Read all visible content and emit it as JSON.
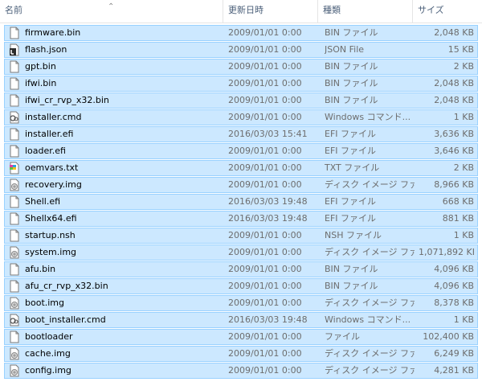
{
  "columns": {
    "name": "名前",
    "date": "更新日時",
    "type": "種類",
    "size": "サイズ"
  },
  "files": [
    {
      "name": "firmware.bin",
      "date": "2009/01/01 0:00",
      "type": "BIN ファイル",
      "size": "2,048 KB",
      "icon": "generic-file-icon"
    },
    {
      "name": "flash.json",
      "date": "2009/01/01 0:00",
      "type": "JSON File",
      "size": "15 KB",
      "icon": "json-file-icon"
    },
    {
      "name": "gpt.bin",
      "date": "2009/01/01 0:00",
      "type": "BIN ファイル",
      "size": "2 KB",
      "icon": "generic-file-icon"
    },
    {
      "name": "ifwi.bin",
      "date": "2009/01/01 0:00",
      "type": "BIN ファイル",
      "size": "2,048 KB",
      "icon": "generic-file-icon"
    },
    {
      "name": "ifwi_cr_rvp_x32.bin",
      "date": "2009/01/01 0:00",
      "type": "BIN ファイル",
      "size": "2,048 KB",
      "icon": "generic-file-icon"
    },
    {
      "name": "installer.cmd",
      "date": "2009/01/01 0:00",
      "type": "Windows コマンド...",
      "size": "1 KB",
      "icon": "cmd-file-icon"
    },
    {
      "name": "installer.efi",
      "date": "2016/03/03 15:41",
      "type": "EFI ファイル",
      "size": "3,636 KB",
      "icon": "generic-file-icon"
    },
    {
      "name": "loader.efi",
      "date": "2009/01/01 0:00",
      "type": "EFI ファイル",
      "size": "3,646 KB",
      "icon": "generic-file-icon"
    },
    {
      "name": "oemvars.txt",
      "date": "2009/01/01 0:00",
      "type": "TXT ファイル",
      "size": "2 KB",
      "icon": "txt-file-icon"
    },
    {
      "name": "recovery.img",
      "date": "2009/01/01 0:00",
      "type": "ディスク イメージ ファ",
      "size": "8,966 KB",
      "icon": "disk-image-icon"
    },
    {
      "name": "Shell.efi",
      "date": "2016/03/03 19:48",
      "type": "EFI ファイル",
      "size": "668 KB",
      "icon": "generic-file-icon"
    },
    {
      "name": "Shellx64.efi",
      "date": "2016/03/03 19:48",
      "type": "EFI ファイル",
      "size": "881 KB",
      "icon": "generic-file-icon"
    },
    {
      "name": "startup.nsh",
      "date": "2009/01/01 0:00",
      "type": "NSH ファイル",
      "size": "1 KB",
      "icon": "generic-file-icon"
    },
    {
      "name": "system.img",
      "date": "2009/01/01 0:00",
      "type": "ディスク イメージ ファ",
      "size": "1,071,892 KB",
      "icon": "disk-image-icon"
    },
    {
      "name": "afu.bin",
      "date": "2009/01/01 0:00",
      "type": "BIN ファイル",
      "size": "4,096 KB",
      "icon": "generic-file-icon"
    },
    {
      "name": "afu_cr_rvp_x32.bin",
      "date": "2009/01/01 0:00",
      "type": "BIN ファイル",
      "size": "4,096 KB",
      "icon": "generic-file-icon"
    },
    {
      "name": "boot.img",
      "date": "2009/01/01 0:00",
      "type": "ディスク イメージ ファ",
      "size": "8,378 KB",
      "icon": "disk-image-icon"
    },
    {
      "name": "boot_installer.cmd",
      "date": "2016/03/03 19:48",
      "type": "Windows コマンド...",
      "size": "1 KB",
      "icon": "cmd-file-icon"
    },
    {
      "name": "bootloader",
      "date": "2009/01/01 0:00",
      "type": "ファイル",
      "size": "102,400 KB",
      "icon": "generic-file-icon"
    },
    {
      "name": "cache.img",
      "date": "2009/01/01 0:00",
      "type": "ディスク イメージ ファ",
      "size": "6,249 KB",
      "icon": "disk-image-icon"
    },
    {
      "name": "config.img",
      "date": "2009/01/01 0:00",
      "type": "ディスク イメージ ファ",
      "size": "4,281 KB",
      "icon": "disk-image-icon"
    }
  ]
}
